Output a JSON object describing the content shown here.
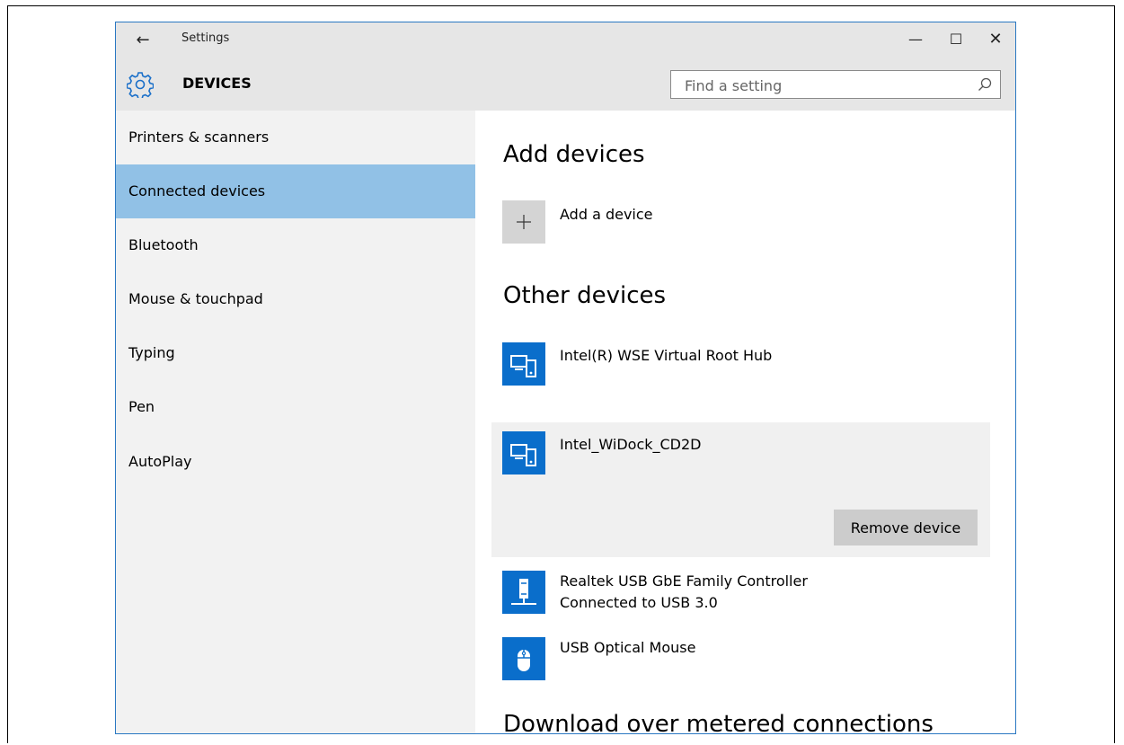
{
  "window": {
    "back_glyph": "←",
    "title": "Settings",
    "minimize_glyph": "—",
    "maximize_glyph": "☐",
    "close_glyph": "✕"
  },
  "header": {
    "icon": "gear-icon",
    "title": "DEVICES",
    "search_placeholder": "Find a setting",
    "search_icon": "search-icon"
  },
  "sidebar": {
    "items": [
      {
        "label": "Printers & scanners",
        "selected": false
      },
      {
        "label": "Connected devices",
        "selected": true
      },
      {
        "label": "Bluetooth",
        "selected": false
      },
      {
        "label": "Mouse & touchpad",
        "selected": false
      },
      {
        "label": "Typing",
        "selected": false
      },
      {
        "label": "Pen",
        "selected": false
      },
      {
        "label": "AutoPlay",
        "selected": false
      }
    ]
  },
  "main": {
    "add_heading": "Add devices",
    "add_device_label": "Add a device",
    "other_heading": "Other devices",
    "devices": [
      {
        "name": "Intel(R) WSE Virtual Root Hub",
        "sub": "",
        "icon": "computer-phone-icon"
      },
      {
        "name": "Intel_WiDock_CD2D",
        "sub": "",
        "icon": "computer-phone-icon",
        "selected": true,
        "action": "Remove device"
      },
      {
        "name": "Realtek USB GbE Family Controller",
        "sub": "Connected to USB 3.0",
        "icon": "network-adapter-icon"
      },
      {
        "name": "USB Optical Mouse",
        "sub": "",
        "icon": "mouse-icon"
      }
    ],
    "download_heading": "Download over metered connections"
  },
  "colors": {
    "accent": "#0a6ecb",
    "selected_nav": "#91c1e6",
    "sidebar_bg": "#f2f2f2",
    "titlebar_bg": "#e6e6e6"
  }
}
